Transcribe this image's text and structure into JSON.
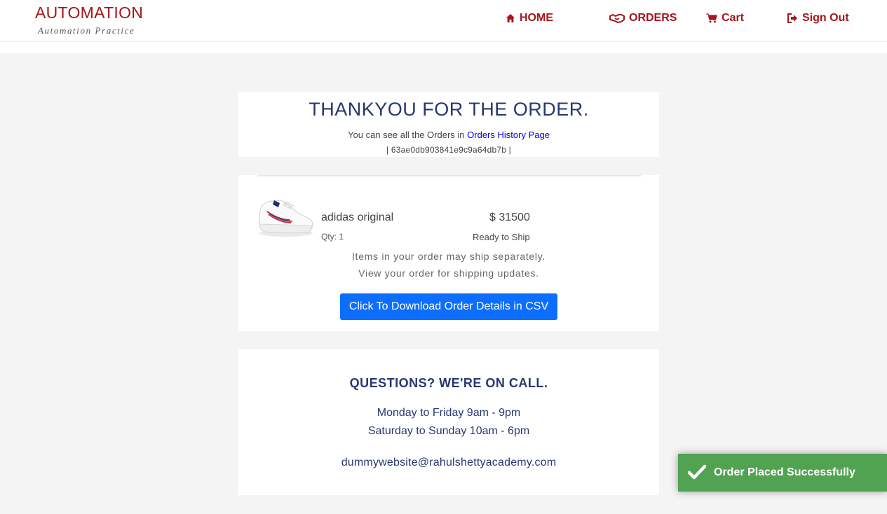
{
  "header": {
    "logo_title": "AUTOMATION",
    "logo_subtitle": "Automation Practice",
    "nav": {
      "home": "HOME",
      "orders": "ORDERS",
      "cart": "Cart",
      "sign_out": "Sign Out"
    }
  },
  "thanks": {
    "title": "THANKYOU FOR THE ORDER.",
    "history_prefix": "You can see all the Orders in",
    "history_link": "Orders History Page",
    "order_id": "| 63ae0db903841e9c9a64db7b |"
  },
  "order": {
    "product_name": "adidas original",
    "quantity": "Qty: 1",
    "price": "$ 31500",
    "status": "Ready to Ship",
    "note_line1": "Items in your order may ship separately.",
    "note_line2": "View your order for shipping updates.",
    "csv_button": "Click To Download Order Details in CSV"
  },
  "contact": {
    "title": "QUESTIONS? WE'RE ON CALL.",
    "weekday_hours": "Monday to Friday 9am - 9pm",
    "weekend_hours": "Saturday to Sunday 10am - 6pm",
    "email": "dummywebsite@rahulshettyacademy.com"
  },
  "toast": {
    "message": "Order Placed Successfully"
  },
  "icons": {
    "home": "home-icon",
    "orders": "handshake-icon",
    "cart": "cart-icon",
    "sign_out": "sign-out-icon",
    "toast": "checkmark-icon"
  },
  "colors": {
    "brand": "#a4161a",
    "heading": "#273773",
    "button": "#0d6efd",
    "link": "#0000ee",
    "toast_bg": "#51a351",
    "page_bg": "#f4f4f4"
  }
}
